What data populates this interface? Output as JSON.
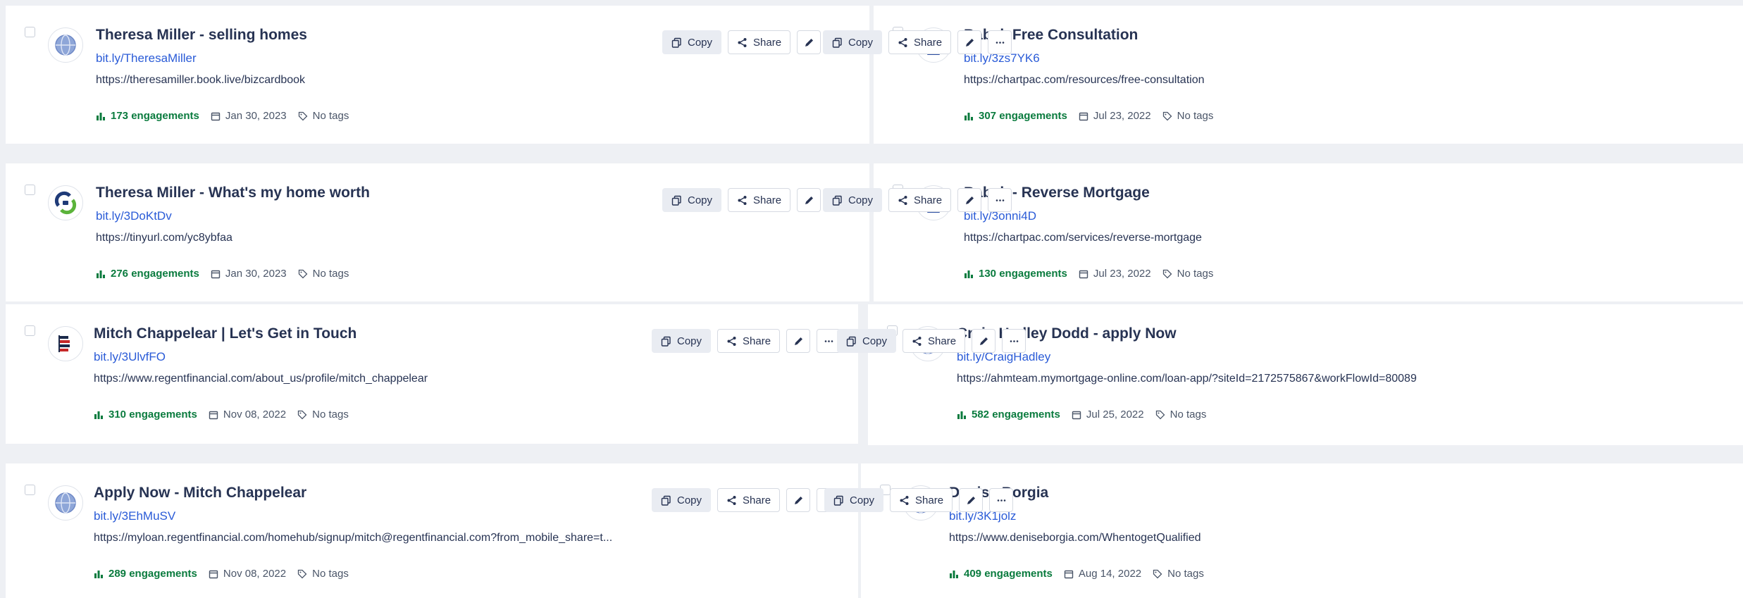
{
  "actions": {
    "copy_label": "Copy",
    "share_label": "Share"
  },
  "cards": [
    {
      "title": "Theresa Miller - selling homes",
      "short_link": "bit.ly/TheresaMiller",
      "long_url": "https://theresamiller.book.live/bizcardbook",
      "engagements": "173 engagements",
      "date": "Jan 30, 2023",
      "tags": "No tags",
      "avatar": "globe-icon"
    },
    {
      "title": "Babak Free Consultation",
      "short_link": "bit.ly/3zs7YK6",
      "long_url": "https://chartpac.com/resources/free-consultation",
      "engagements": "307 engagements",
      "date": "Jul 23, 2022",
      "tags": "No tags",
      "avatar": "tower-logo-icon"
    },
    {
      "title": "Theresa Miller - What's my home worth",
      "short_link": "bit.ly/3DoKtDv",
      "long_url": "https://tinyurl.com/yc8ybfaa",
      "engagements": "276 engagements",
      "date": "Jan 30, 2023",
      "tags": "No tags",
      "avatar": "tinyurl-logo-icon"
    },
    {
      "title": "Babak - Reverse Mortgage",
      "short_link": "bit.ly/3onni4D",
      "long_url": "https://chartpac.com/services/reverse-mortgage",
      "engagements": "130 engagements",
      "date": "Jul 23, 2022",
      "tags": "No tags",
      "avatar": "tower-logo-icon"
    },
    {
      "title": "Mitch Chappelear | Let's Get in Touch",
      "short_link": "bit.ly/3UlvfFO",
      "long_url": "https://www.regentfinancial.com/about_us/profile/mitch_chappelear",
      "engagements": "310 engagements",
      "date": "Nov 08, 2022",
      "tags": "No tags",
      "avatar": "regent-logo-icon"
    },
    {
      "title": "Craig Hadley Dodd - apply Now",
      "short_link": "bit.ly/CraigHadley",
      "long_url": "https://ahmteam.mymortgage-online.com/loan-app/?siteId=2172575867&workFlowId=80089",
      "engagements": "582 engagements",
      "date": "Jul 25, 2022",
      "tags": "No tags",
      "avatar": "globe-icon"
    },
    {
      "title": "Apply Now - Mitch Chappelear",
      "short_link": "bit.ly/3EhMuSV",
      "long_url": "https://myloan.regentfinancial.com/homehub/signup/mitch@regentfinancial.com?from_mobile_share=t...",
      "engagements": "289 engagements",
      "date": "Nov 08, 2022",
      "tags": "No tags",
      "avatar": "globe-icon"
    },
    {
      "title": "Denise Borgia",
      "short_link": "bit.ly/3K1jolz",
      "long_url": "https://www.deniseborgia.com/WhentogetQualified",
      "engagements": "409 engagements",
      "date": "Aug 14, 2022",
      "tags": "No tags",
      "avatar": "globe-icon"
    }
  ]
}
